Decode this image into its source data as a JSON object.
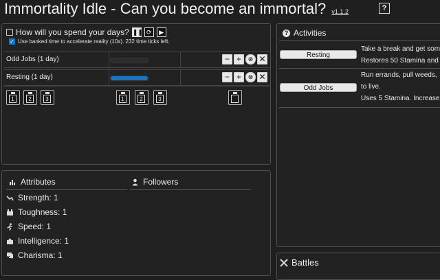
{
  "app": {
    "title": "Immortality Idle - Can you become an immortal?",
    "version": "v1.1.2",
    "help_icon": "question-square-icon",
    "help_glyph": "?"
  },
  "queue": {
    "title": "How will you spend your days?",
    "controls": {
      "pause_icon": "pause-icon",
      "pause_glyph": "❚❚",
      "repeat_icon": "repeat-icon",
      "repeat_glyph": "⟳",
      "play_icon": "play-icon",
      "play_glyph": "▶"
    },
    "bank_check_glyph": "✓",
    "bank_text": "Use banked time to accelerate reality (10x). 232 time ticks left.",
    "row_button_glyphs": {
      "minus": "−",
      "plus": "+",
      "stop": "⊗",
      "close": "✕"
    },
    "rows": [
      {
        "label": "Odd Jobs (1 day)",
        "progress": 0
      },
      {
        "label": "Resting (1 day)",
        "progress": 1
      }
    ],
    "schedule_slots": [
      "1",
      "2",
      "3"
    ],
    "load_slots": [
      "1",
      "2",
      "3"
    ],
    "delete_icon": "trash-icon"
  },
  "activities": {
    "title": "Activities",
    "items": [
      {
        "button": "Resting",
        "lines": [
          "Take a break and get som",
          "Restores 50 Stamina and"
        ]
      },
      {
        "button": "Odd Jobs",
        "lines": [
          "Run errands, pull weeds,",
          "to live.",
          "Uses 5 Stamina. Increase"
        ]
      }
    ]
  },
  "attributes": {
    "title": "Attributes",
    "items": [
      {
        "label": "Strength: 1",
        "icon": "strength-icon"
      },
      {
        "label": "Toughness: 1",
        "icon": "toughness-icon"
      },
      {
        "label": "Speed: 1",
        "icon": "speed-icon"
      },
      {
        "label": "Intelligence: 1",
        "icon": "intelligence-icon"
      },
      {
        "label": "Charisma: 1",
        "icon": "charisma-icon"
      }
    ]
  },
  "followers": {
    "title": "Followers"
  },
  "battles": {
    "title": "Battles"
  },
  "colors": {
    "accent": "#1e73be",
    "panel": "#222222",
    "background": "#1f1f1f"
  }
}
